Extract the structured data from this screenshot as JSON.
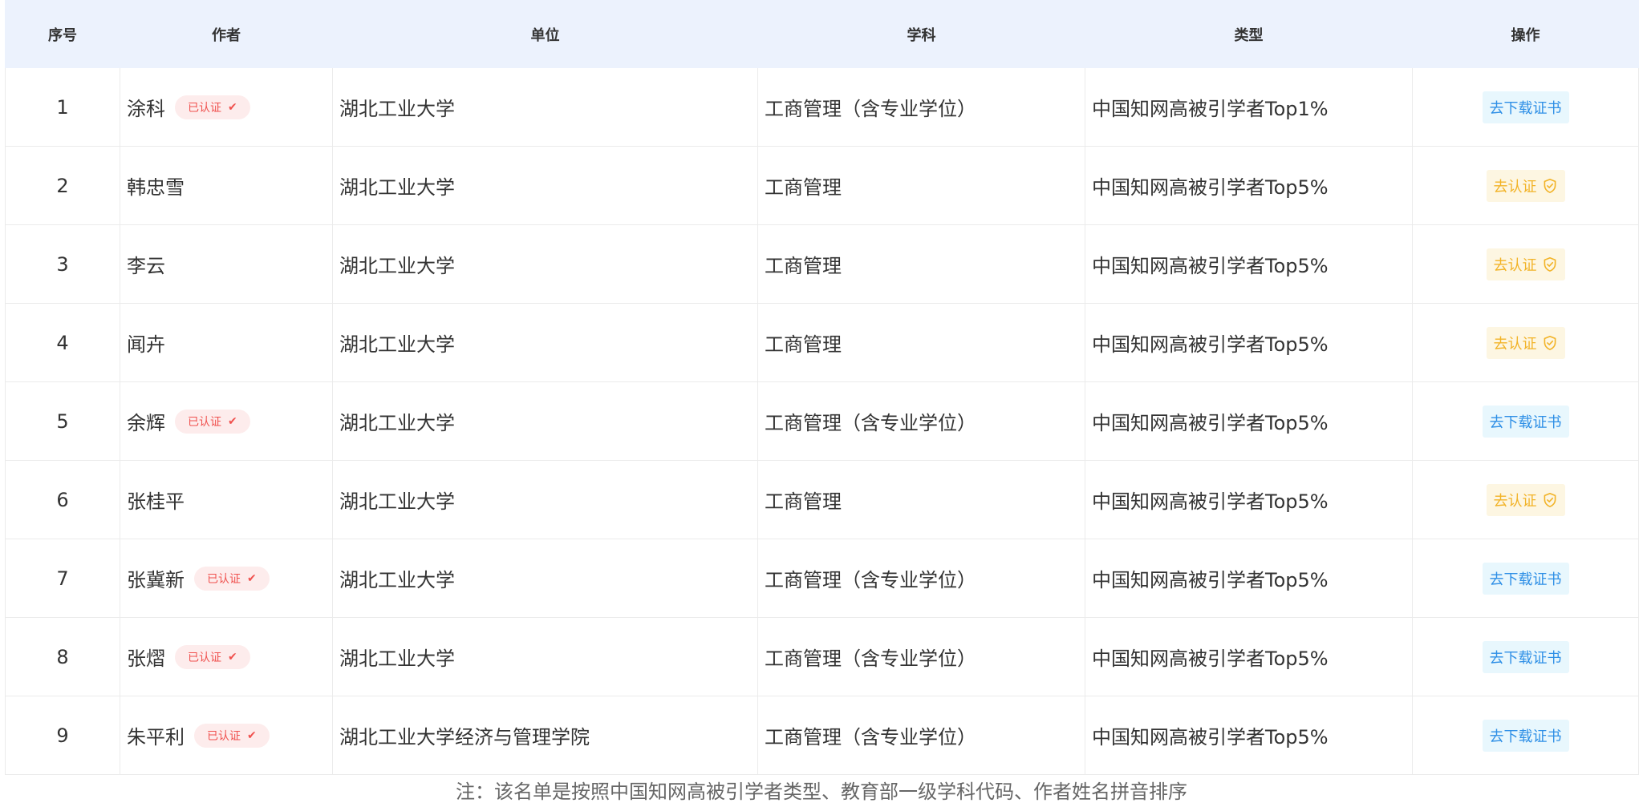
{
  "table": {
    "headers": [
      "序号",
      "作者",
      "单位",
      "学科",
      "类型",
      "操作"
    ],
    "rows": [
      {
        "index": "1",
        "author": "涂科",
        "verified": true,
        "unit": "湖北工业大学",
        "subject": "工商管理（含专业学位）",
        "type": "中国知网高被引学者Top1%",
        "action": "去下载证书"
      },
      {
        "index": "2",
        "author": "韩忠雪",
        "verified": false,
        "unit": "湖北工业大学",
        "subject": "工商管理",
        "type": "中国知网高被引学者Top5%",
        "action": "去认证"
      },
      {
        "index": "3",
        "author": "李云",
        "verified": false,
        "unit": "湖北工业大学",
        "subject": "工商管理",
        "type": "中国知网高被引学者Top5%",
        "action": "去认证"
      },
      {
        "index": "4",
        "author": "闻卉",
        "verified": false,
        "unit": "湖北工业大学",
        "subject": "工商管理",
        "type": "中国知网高被引学者Top5%",
        "action": "去认证"
      },
      {
        "index": "5",
        "author": "余辉",
        "verified": true,
        "unit": "湖北工业大学",
        "subject": "工商管理（含专业学位）",
        "type": "中国知网高被引学者Top5%",
        "action": "去下载证书"
      },
      {
        "index": "6",
        "author": "张桂平",
        "verified": false,
        "unit": "湖北工业大学",
        "subject": "工商管理",
        "type": "中国知网高被引学者Top5%",
        "action": "去认证"
      },
      {
        "index": "7",
        "author": "张冀新",
        "verified": true,
        "unit": "湖北工业大学",
        "subject": "工商管理（含专业学位）",
        "type": "中国知网高被引学者Top5%",
        "action": "去下载证书"
      },
      {
        "index": "8",
        "author": "张熠",
        "verified": true,
        "unit": "湖北工业大学",
        "subject": "工商管理（含专业学位）",
        "type": "中国知网高被引学者Top5%",
        "action": "去下载证书"
      },
      {
        "index": "9",
        "author": "朱平利",
        "verified": true,
        "unit": "湖北工业大学经济与管理学院",
        "subject": "工商管理（含专业学位）",
        "type": "中国知网高被引学者Top5%",
        "action": "去下载证书"
      }
    ]
  },
  "badges": {
    "verified_label": "已认证",
    "verified_icon": "check-icon",
    "verify_icon": "shield-check-icon"
  },
  "footer": {
    "note": "注：该名单是按照中国知网高被引学者类型、教育部一级学科代码、作者姓名拼音排序"
  },
  "colors": {
    "header_bg": "#ecf2fd",
    "verified_bg": "#fdecec",
    "verified_text": "#f0514e",
    "download_bg": "#e8f7fd",
    "download_text": "#2e8fe6",
    "verify_bg": "#fdf6e2",
    "verify_text": "#f2b327"
  }
}
